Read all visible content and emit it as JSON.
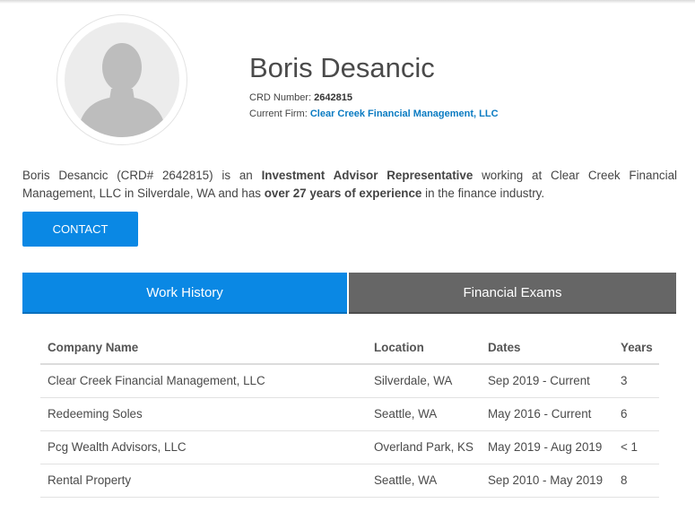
{
  "profile": {
    "name": "Boris Desancic",
    "crd_label": "CRD Number:",
    "crd_number": "2642815",
    "firm_label": "Current Firm:",
    "firm_name": "Clear Creek Financial Management, LLC"
  },
  "bio": {
    "part1": "Boris Desancic (CRD# 2642815) is an ",
    "role": "Investment Advisor Representative",
    "part2": " working at Clear Creek Financial Management, LLC in Silverdale, WA and has ",
    "experience": "over 27 years of experience",
    "part3": " in the finance industry."
  },
  "contact_button": "CONTACT",
  "tabs": [
    {
      "label": "Work History",
      "active": true
    },
    {
      "label": "Financial Exams",
      "active": false
    }
  ],
  "work_table": {
    "headers": [
      "Company Name",
      "Location",
      "Dates",
      "Years"
    ],
    "rows": [
      [
        "Clear Creek Financial Management, LLC",
        "Silverdale, WA",
        "Sep 2019 - Current",
        "3"
      ],
      [
        "Redeeming Soles",
        "Seattle, WA",
        "May 2016 - Current",
        "6"
      ],
      [
        "Pcg Wealth Advisors, LLC",
        "Overland Park, KS",
        "May 2019 - Aug 2019",
        "< 1"
      ],
      [
        "Rental Property",
        "Seattle, WA",
        "Sep 2010 - May 2019",
        "8"
      ]
    ]
  },
  "colors": {
    "accent": "#0a88e4",
    "link": "#0a7bc2",
    "inactive_tab": "#666666"
  },
  "icons": {
    "avatar": "default-person-silhouette"
  }
}
